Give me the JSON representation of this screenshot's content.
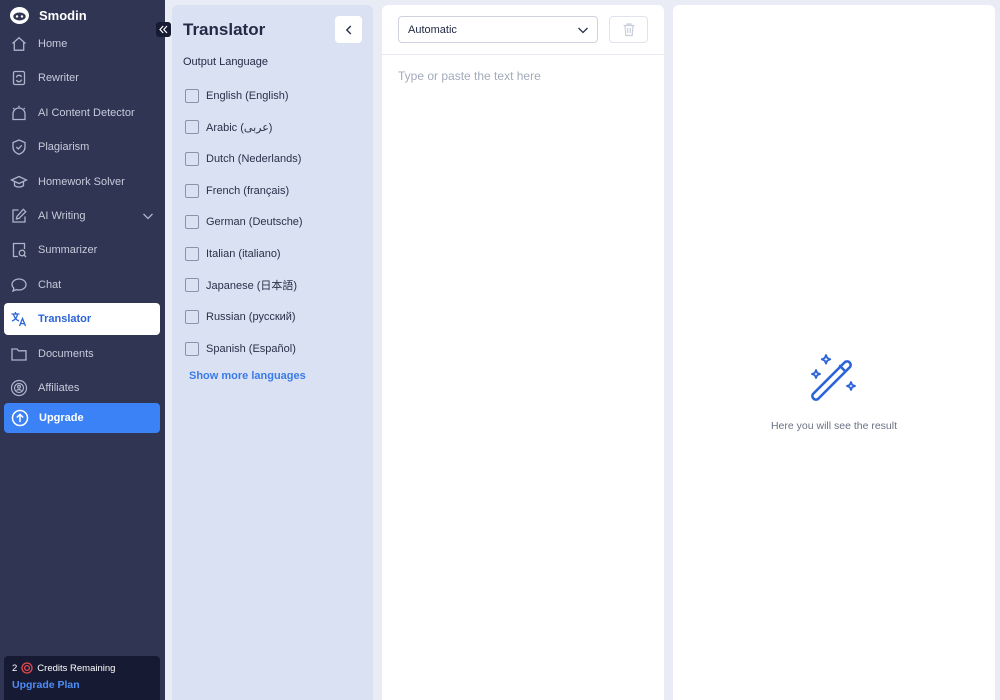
{
  "app": {
    "name": "Smodin"
  },
  "sidebar": {
    "items": [
      {
        "label": "Home",
        "icon": "home-icon"
      },
      {
        "label": "Rewriter",
        "icon": "rewriter-icon"
      },
      {
        "label": "AI Content Detector",
        "icon": "ai-detector-icon"
      },
      {
        "label": "Plagiarism",
        "icon": "shield-check-icon"
      },
      {
        "label": "Homework Solver",
        "icon": "graduation-cap-icon"
      },
      {
        "label": "AI Writing",
        "icon": "pencil-square-icon"
      },
      {
        "label": "Summarizer",
        "icon": "summarizer-icon"
      },
      {
        "label": "Chat",
        "icon": "chat-bubble-icon"
      },
      {
        "label": "Translator",
        "icon": "translate-icon"
      },
      {
        "label": "Documents",
        "icon": "folder-icon"
      },
      {
        "label": "Affiliates",
        "icon": "affiliates-icon"
      }
    ],
    "active": "Translator",
    "upgrade_label": "Upgrade",
    "credits": {
      "count": "2",
      "label": "Credits Remaining",
      "upgrade_plan": "Upgrade Plan"
    }
  },
  "lang_panel": {
    "title": "Translator",
    "output_label": "Output Language",
    "languages": [
      "English (English)",
      "Arabic (عربى)",
      "Dutch (Nederlands)",
      "French (français)",
      "German (Deutsche)",
      "Italian (italiano)",
      "Japanese (日本語)",
      "Russian (русский)",
      "Spanish (Español)"
    ],
    "show_more": "Show more languages"
  },
  "input": {
    "source_language": "Automatic",
    "placeholder": "Type or paste the text here"
  },
  "result": {
    "hint": "Here you will see the result"
  },
  "colors": {
    "sidebar_bg": "#2f3553",
    "accent": "#3b82f6",
    "panel_bg": "#dae1f3",
    "link": "#3b7be8"
  }
}
